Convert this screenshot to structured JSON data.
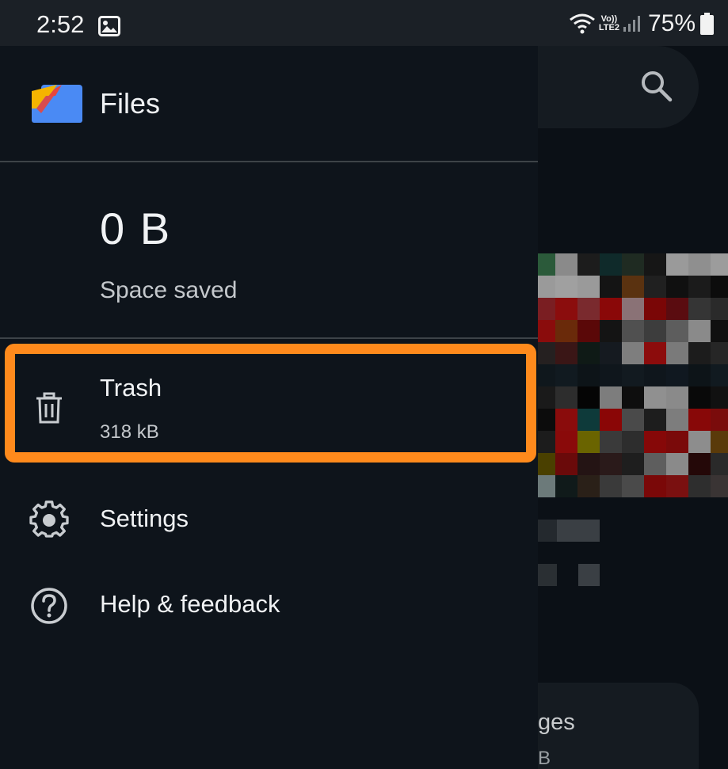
{
  "status_bar": {
    "time": "2:52",
    "volte_line1": "Vo))",
    "volte_line2": "LTE2",
    "battery_percent": "75%",
    "icons": [
      "gallery-icon",
      "wifi-icon",
      "signal-icon",
      "battery-icon"
    ]
  },
  "drawer": {
    "app_title": "Files",
    "space_saved_value": "0 B",
    "space_saved_label": "Space saved",
    "items": [
      {
        "label": "Trash",
        "sublabel": "318 kB",
        "icon": "trash-icon",
        "highlighted": true
      },
      {
        "label": "Settings",
        "icon": "gear-icon"
      },
      {
        "label": "Help & feedback",
        "icon": "help-icon"
      }
    ]
  },
  "background": {
    "search_icon": "search-icon",
    "card_title_partial": "ges",
    "card_sub_partial": "B"
  },
  "colors": {
    "highlight": "#ff8a1c",
    "drawer_bg": "#0e141b",
    "status_bar_bg": "#1b2026"
  }
}
